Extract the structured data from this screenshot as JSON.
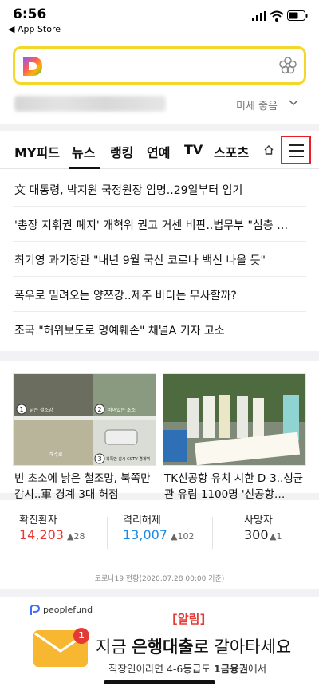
{
  "status_bar": {
    "time": "6:56",
    "back_app": "◀ App Store"
  },
  "search": {
    "logo_letter": "D",
    "location_text": "",
    "dust_label": "미세 좋음"
  },
  "tabs": [
    {
      "label": "MY피드"
    },
    {
      "label": "뉴스"
    },
    {
      "label": "랭킹"
    },
    {
      "label": "연예"
    },
    {
      "label": "TV"
    },
    {
      "label": "스포츠"
    }
  ],
  "news": [
    "文 대통령, 박지원 국정원장 임명..29일부터 임기",
    "'총장 지휘권 폐지' 개혁위 권고 거센 비판..법무부 \"심층 …",
    "최기영 과기장관 \"내년 9월 국산 코로나 백신 나올 듯\"",
    "폭우로 밀려오는 양쯔강..제주 바다는 무사할까?",
    "조국 \"허위보도로 명예훼손\" 채널A 기자 고소"
  ],
  "cards": [
    {
      "title": "빈 초소에 낡은 철조망, 북쪽만 감시..軍 경계 3대 허점",
      "img_labels": [
        "낡은 철조망",
        "비어있는 초소",
        "해수로",
        "북쪽만 감시 CCTV 경계벽"
      ]
    },
    {
      "title": "TK신공항 유치 시한 D-3..성균관 유림 1100명 '신공항…"
    }
  ],
  "covid": {
    "confirmed_label": "확진환자",
    "confirmed_value": "14,203",
    "confirmed_delta": "▲28",
    "released_label": "격리해제",
    "released_value": "13,007",
    "released_delta": "▲102",
    "deaths_label": "사망자",
    "deaths_value": "300",
    "deaths_delta": "▲1",
    "note": "코로나19 현황(2020.07.28 00:00 기준)",
    "colors": {
      "confirmed": "#e53935",
      "released": "#1e88e5",
      "deaths": "#222222"
    }
  },
  "ad": {
    "brand": "peoplefund",
    "badge": "1",
    "alert": "[알림]",
    "headline_pre": "지금 ",
    "headline_bold": "은행대출",
    "headline_post": "로 갈아타세요",
    "sub_pre": "직장인이라면 4-6등급도 ",
    "sub_bold": "1금융권",
    "sub_post": "에서"
  },
  "colors": {
    "search_border": "#f2d82a",
    "menu_highlight": "#e81e25"
  }
}
